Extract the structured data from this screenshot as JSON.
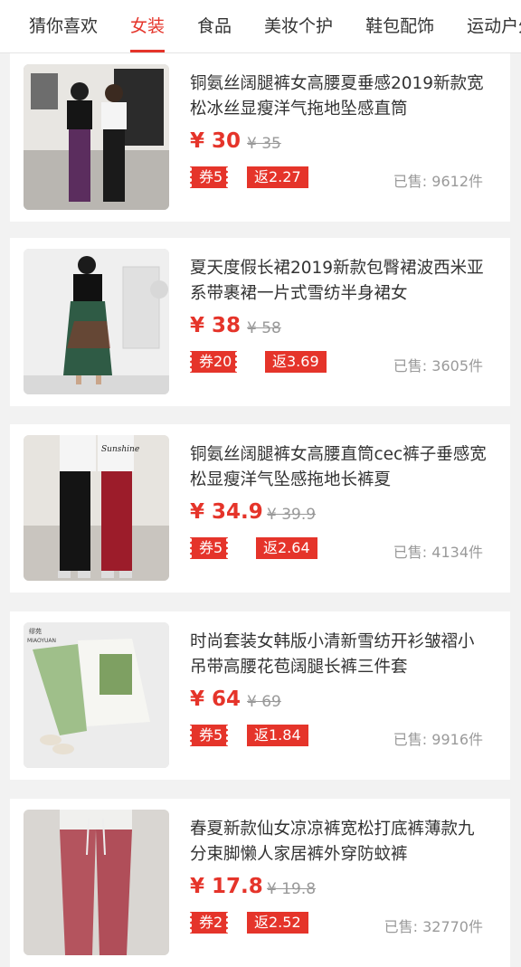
{
  "tabs": [
    {
      "label": "猜你喜欢",
      "active": false
    },
    {
      "label": "女装",
      "active": true
    },
    {
      "label": "食品",
      "active": false
    },
    {
      "label": "美妆个护",
      "active": false
    },
    {
      "label": "鞋包配饰",
      "active": false
    },
    {
      "label": "运动户外",
      "active": false
    }
  ],
  "products": [
    {
      "title": "铜氨丝阔腿裤女高腰夏垂感2019新款宽松冰丝显瘦洋气拖地坠感直筒",
      "price": "¥ 30",
      "original": "¥ 35",
      "coupon": "券5",
      "rebate": "返2.27",
      "sold": "已售: 9612件"
    },
    {
      "title": "夏天度假长裙2019新款包臀裙波西米亚系带裹裙一片式雪纺半身裙女",
      "price": "¥ 38",
      "original": "¥ 58",
      "coupon": "券20",
      "rebate": "返3.69",
      "sold": "已售: 3605件"
    },
    {
      "title": "铜氨丝阔腿裤女高腰直筒cec裤子垂感宽松显瘦洋气坠感拖地长裤夏",
      "price": "¥ 34.9",
      "original": "¥ 39.9",
      "coupon": "券5",
      "rebate": "返2.64",
      "sold": "已售: 4134件"
    },
    {
      "title": "时尚套装女韩版小清新雪纺开衫皱褶小吊带高腰花苞阔腿长裤三件套",
      "price": "¥ 64",
      "original": "¥ 69",
      "coupon": "券5",
      "rebate": "返1.84",
      "sold": "已售: 9916件"
    },
    {
      "title": "春夏新款仙女凉凉裤宽松打底裤薄款九分束脚懒人家居裤外穿防蚊裤",
      "price": "¥ 17.8",
      "original": "¥ 19.8",
      "coupon": "券2",
      "rebate": "返2.52",
      "sold": "已售: 32770件"
    }
  ],
  "logo_text": "缪苑 MIAOYUAN",
  "colors": {
    "accent": "#e5342a",
    "muted": "#999999"
  }
}
